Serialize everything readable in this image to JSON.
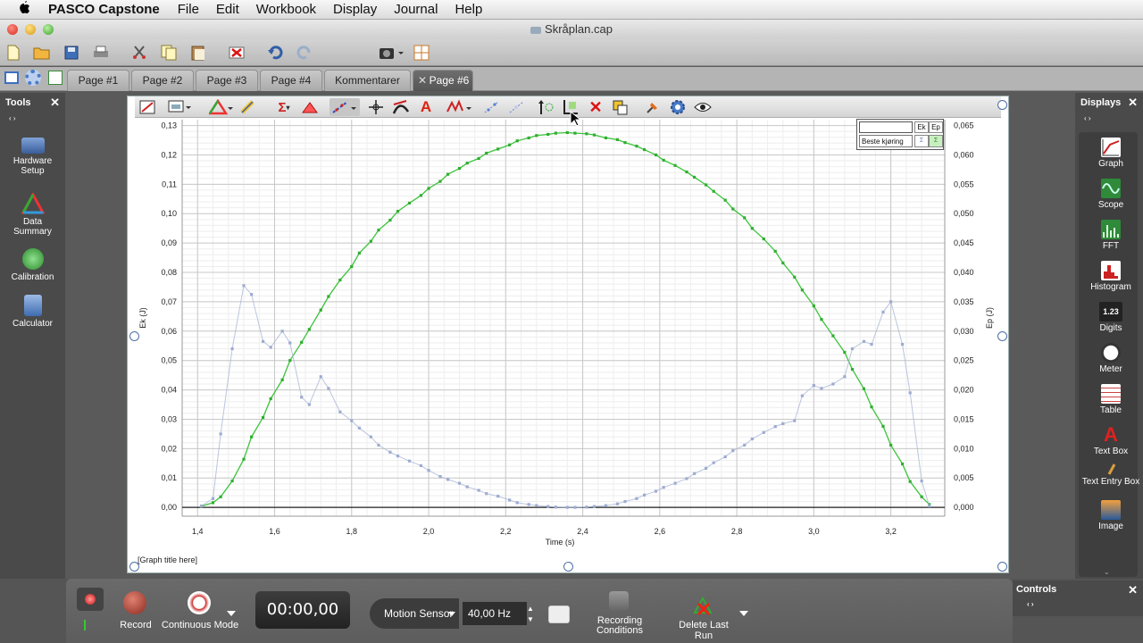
{
  "menubar": {
    "app_name": "PASCO Capstone",
    "items": [
      "File",
      "Edit",
      "Workbook",
      "Display",
      "Journal",
      "Help"
    ]
  },
  "window": {
    "title": "Skråplan.cap"
  },
  "tabs": [
    {
      "label": "Page #1"
    },
    {
      "label": "Page #2"
    },
    {
      "label": "Page #3"
    },
    {
      "label": "Page #4"
    },
    {
      "label": "Kommentarer"
    },
    {
      "label": "Page #6",
      "active": true
    }
  ],
  "tools_panel": {
    "title": "Tools",
    "items": [
      {
        "label_line1": "Hardware",
        "label_line2": "Setup",
        "icon": "hardware-setup-icon"
      },
      {
        "label_line1": "Data",
        "label_line2": "Summary",
        "icon": "data-summary-icon"
      },
      {
        "label_line1": "Calibration",
        "label_line2": "",
        "icon": "calibration-icon"
      },
      {
        "label_line1": "Calculator",
        "label_line2": "",
        "icon": "calculator-icon"
      }
    ]
  },
  "displays_panel": {
    "title": "Displays",
    "items": [
      {
        "label": "Graph",
        "icon": "graph-icon"
      },
      {
        "label": "Scope",
        "icon": "scope-icon"
      },
      {
        "label": "FFT",
        "icon": "fft-icon"
      },
      {
        "label": "Histogram",
        "icon": "histogram-icon"
      },
      {
        "label": "Digits",
        "icon": "digits-icon",
        "icon_text": "1.23"
      },
      {
        "label": "Meter",
        "icon": "meter-icon"
      },
      {
        "label": "Table",
        "icon": "table-icon"
      },
      {
        "label": "Text Box",
        "icon": "text-box-icon"
      },
      {
        "label": "Text Entry Box",
        "icon": "text-entry-box-icon"
      },
      {
        "label": "Image",
        "icon": "image-icon"
      }
    ]
  },
  "graph": {
    "title_placeholder": "[Graph title here]",
    "legend": {
      "col1": "Ek",
      "col2": "Ep",
      "run_label": "Beste kjøring",
      "symbol": "Σ"
    }
  },
  "chart_data": {
    "type": "scatter",
    "xlabel": "Time (s)",
    "ylabel": "Ek (J)",
    "y2label": "Ep (J)",
    "xlim": [
      1.36,
      3.34
    ],
    "ylim": [
      -0.003,
      0.132
    ],
    "y2lim": [
      -0.0015,
      0.066
    ],
    "x_ticks": [
      "1,4",
      "1,6",
      "1,8",
      "2,0",
      "2,2",
      "2,4",
      "2,6",
      "2,8",
      "3,0",
      "3,2"
    ],
    "x_tick_values": [
      1.4,
      1.6,
      1.8,
      2.0,
      2.2,
      2.4,
      2.6,
      2.8,
      3.0,
      3.2
    ],
    "y_ticks": [
      "0,00",
      "0,01",
      "0,02",
      "0,03",
      "0,04",
      "0,05",
      "0,06",
      "0,07",
      "0,08",
      "0,09",
      "0,10",
      "0,11",
      "0,12",
      "0,13"
    ],
    "y_tick_values": [
      0,
      0.01,
      0.02,
      0.03,
      0.04,
      0.05,
      0.06,
      0.07,
      0.08,
      0.09,
      0.1,
      0.11,
      0.12,
      0.13
    ],
    "y2_ticks": [
      "0,000",
      "0,005",
      "0,010",
      "0,015",
      "0,020",
      "0,025",
      "0,030",
      "0,035",
      "0,040",
      "0,045",
      "0,050",
      "0,055",
      "0,060",
      "0,065"
    ],
    "y2_tick_values": [
      0,
      0.005,
      0.01,
      0.015,
      0.02,
      0.025,
      0.03,
      0.035,
      0.04,
      0.045,
      0.05,
      0.055,
      0.06,
      0.065
    ],
    "series": [
      {
        "name": "Ep",
        "axis": "right",
        "color": "#3cc43c",
        "x": [
          1.41,
          1.44,
          1.46,
          1.49,
          1.52,
          1.54,
          1.57,
          1.59,
          1.62,
          1.64,
          1.67,
          1.69,
          1.72,
          1.74,
          1.77,
          1.8,
          1.82,
          1.85,
          1.87,
          1.9,
          1.92,
          1.95,
          1.98,
          2.0,
          2.03,
          2.05,
          2.08,
          2.1,
          2.13,
          2.15,
          2.18,
          2.21,
          2.23,
          2.26,
          2.28,
          2.31,
          2.33,
          2.36,
          2.38,
          2.41,
          2.43,
          2.46,
          2.49,
          2.51,
          2.54,
          2.56,
          2.59,
          2.61,
          2.64,
          2.67,
          2.69,
          2.72,
          2.74,
          2.77,
          2.79,
          2.82,
          2.84,
          2.87,
          2.9,
          2.92,
          2.95,
          2.97,
          3.0,
          3.02,
          3.05,
          3.08,
          3.1,
          3.13,
          3.15,
          3.18,
          3.2,
          3.23,
          3.25,
          3.28,
          3.3
        ],
        "y": [
          0.0002,
          0.0008,
          0.0018,
          0.0045,
          0.0082,
          0.012,
          0.0153,
          0.0185,
          0.0217,
          0.025,
          0.0281,
          0.0303,
          0.0336,
          0.0359,
          0.0387,
          0.041,
          0.0433,
          0.0453,
          0.0472,
          0.0489,
          0.0504,
          0.0518,
          0.0531,
          0.0543,
          0.0555,
          0.0567,
          0.0577,
          0.0586,
          0.0594,
          0.0603,
          0.061,
          0.0617,
          0.0624,
          0.0629,
          0.0633,
          0.0635,
          0.0637,
          0.0638,
          0.0637,
          0.0636,
          0.0634,
          0.0629,
          0.0626,
          0.0621,
          0.0615,
          0.0609,
          0.06,
          0.0591,
          0.0582,
          0.0571,
          0.0562,
          0.0549,
          0.0538,
          0.0523,
          0.0508,
          0.0493,
          0.0475,
          0.0457,
          0.0436,
          0.0416,
          0.0392,
          0.037,
          0.0343,
          0.032,
          0.0292,
          0.0264,
          0.0235,
          0.0202,
          0.0171,
          0.0138,
          0.0106,
          0.0074,
          0.0044,
          0.0018,
          0.0005
        ]
      },
      {
        "name": "Ek",
        "axis": "left",
        "color": "#a9b6d6",
        "x": [
          1.41,
          1.44,
          1.46,
          1.49,
          1.52,
          1.54,
          1.57,
          1.59,
          1.62,
          1.64,
          1.67,
          1.69,
          1.72,
          1.74,
          1.77,
          1.8,
          1.82,
          1.85,
          1.87,
          1.9,
          1.92,
          1.95,
          1.98,
          2.0,
          2.03,
          2.05,
          2.08,
          2.1,
          2.13,
          2.15,
          2.18,
          2.21,
          2.23,
          2.26,
          2.28,
          2.31,
          2.33,
          2.36,
          2.38,
          2.41,
          2.43,
          2.46,
          2.49,
          2.51,
          2.54,
          2.56,
          2.59,
          2.61,
          2.64,
          2.67,
          2.69,
          2.72,
          2.74,
          2.77,
          2.79,
          2.82,
          2.84,
          2.87,
          2.9,
          2.92,
          2.95,
          2.97,
          3.0,
          3.02,
          3.05,
          3.08,
          3.1,
          3.13,
          3.15,
          3.18,
          3.2,
          3.23,
          3.25,
          3.28,
          3.3
        ],
        "y": [
          0.0005,
          0.003,
          0.025,
          0.054,
          0.0755,
          0.0725,
          0.0565,
          0.0545,
          0.06,
          0.056,
          0.0375,
          0.035,
          0.0445,
          0.0405,
          0.0325,
          0.0295,
          0.027,
          0.024,
          0.0212,
          0.0188,
          0.0175,
          0.0158,
          0.0142,
          0.0126,
          0.0105,
          0.0095,
          0.0082,
          0.007,
          0.0058,
          0.0047,
          0.0038,
          0.0025,
          0.0016,
          0.001,
          0.0006,
          0.0003,
          0.0001,
          0.0,
          0.0,
          0.0001,
          0.0003,
          0.0006,
          0.0012,
          0.002,
          0.003,
          0.0042,
          0.0055,
          0.0068,
          0.0082,
          0.0098,
          0.0115,
          0.0133,
          0.0152,
          0.0172,
          0.0193,
          0.0212,
          0.0233,
          0.0255,
          0.0275,
          0.0285,
          0.0295,
          0.038,
          0.0415,
          0.0405,
          0.042,
          0.0445,
          0.054,
          0.0565,
          0.0555,
          0.0665,
          0.07,
          0.0555,
          0.039,
          0.009,
          0.0005
        ]
      }
    ],
    "grid": true
  },
  "controls": {
    "record_label": "Record",
    "mode_label": "Continuous Mode",
    "timer": "00:00,00",
    "sensor": "Motion Sensor",
    "sample_rate": "40,00 Hz",
    "recording_conditions_line1": "Recording",
    "recording_conditions_line2": "Conditions",
    "delete_last_run": "Delete Last Run",
    "panel_title": "Controls"
  }
}
